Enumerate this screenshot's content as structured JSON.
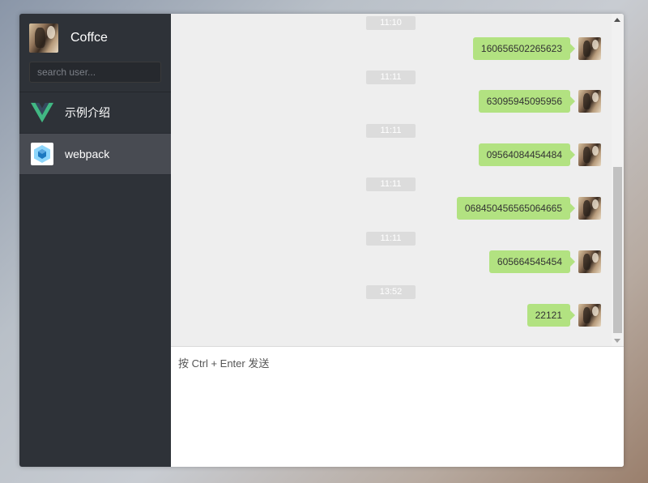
{
  "user": {
    "name": "Coffce"
  },
  "search": {
    "placeholder": "search user..."
  },
  "sessions": [
    {
      "label": "示例介绍",
      "icon": "vue-logo-icon",
      "active": false
    },
    {
      "label": "webpack",
      "icon": "webpack-logo-icon",
      "active": true
    }
  ],
  "messages": [
    {
      "time": "11:10",
      "text": "160656502265623"
    },
    {
      "time": "11:11",
      "text": "63095945095956"
    },
    {
      "time": "11:11",
      "text": "09564084454484"
    },
    {
      "time": "11:11",
      "text": "068450456565064665"
    },
    {
      "time": "11:11",
      "text": "605664545454"
    },
    {
      "time": "13:52",
      "text": "22121"
    }
  ],
  "composer": {
    "placeholder": "按 Ctrl + Enter 发送"
  },
  "colors": {
    "sidebar": "#2e3238",
    "bubble": "#b2e281",
    "chat_bg": "#eeeeee",
    "active_session": "#484b52"
  }
}
